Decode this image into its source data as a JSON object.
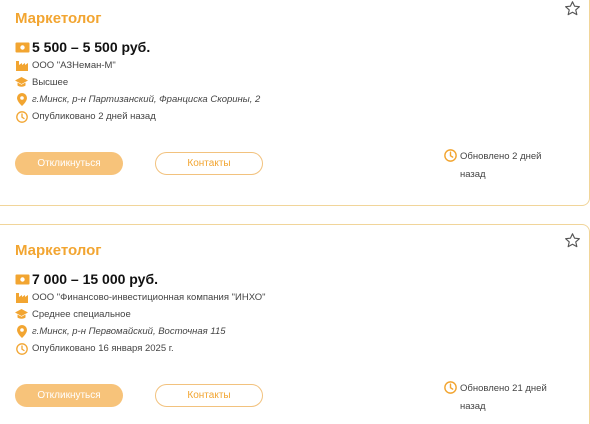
{
  "colors": {
    "accent": "#f2a531",
    "button_fill": "#f7c37a",
    "border": "#f1d59a"
  },
  "vacancies": [
    {
      "title": "Маркетолог",
      "salary": "5 500 – 5 500 руб.",
      "company": "ООО \"АЗНеман-М\"",
      "education": "Высшее",
      "address": "г.Минск, р-н Партизанский, Франциска Скорины, 2",
      "published": "Опубликовано 2 дней назад",
      "apply_label": "Откликнуться",
      "contacts_label": "Контакты",
      "updated": "Обновлено 2 дней назад"
    },
    {
      "title": "Маркетолог",
      "salary": "7 000 – 15 000 руб.",
      "company": "ООО \"Финансово-инвестиционная компания \"ИНХО\"",
      "education": "Среднее специальное",
      "address": "г.Минск, р-н Первомайский, Восточная 115",
      "published": "Опубликовано 16 января 2025 г.",
      "apply_label": "Откликнуться",
      "contacts_label": "Контакты",
      "updated": "Обновлено 21 дней назад"
    }
  ]
}
